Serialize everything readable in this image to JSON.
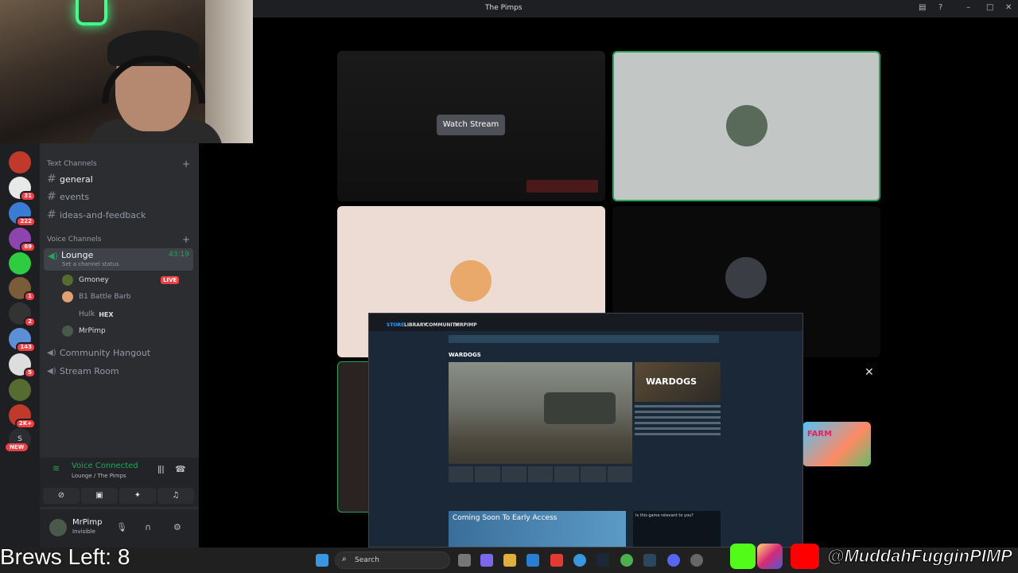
{
  "window": {
    "title": "The Pimps"
  },
  "server_badges": [
    "31",
    "222",
    "69",
    "1",
    "2",
    "143",
    "5",
    "2K+"
  ],
  "server_new_badge": "NEW",
  "server_letter": "S",
  "sidebar": {
    "text_category": "Text Channels",
    "text_channels": [
      "general",
      "events",
      "ideas-and-feedback"
    ],
    "voice_category": "Voice Channels",
    "lounge": {
      "name": "Lounge",
      "status_placeholder": "Set a channel status",
      "timer": "43:19"
    },
    "members": [
      {
        "name": "Gmoney",
        "badge": "LIVE"
      },
      {
        "name": "B1 Battle Barb"
      },
      {
        "name": "Hulk",
        "tag": "HEX"
      },
      {
        "name": "MrPimp"
      }
    ],
    "other_voice": [
      "Community Hangout",
      "Stream Room"
    ]
  },
  "voice_panel": {
    "title": "Voice Connected",
    "subtitle": "Lounge / The Pimps"
  },
  "user_bar": {
    "name": "MrPimp",
    "status": "Invisible"
  },
  "stage": {
    "watch_label": "Watch Stream",
    "close_icon": "close-icon"
  },
  "farm_label": "FARM",
  "steam": {
    "nav": [
      "STORE",
      "LIBRARY",
      "COMMUNITY",
      "MRPIMP"
    ],
    "game_title": "WARDOGS",
    "capsule_label": "WARDOGS",
    "coming_soon": "Coming Soon To Early Access",
    "relevant": "Is this game relevant to you?"
  },
  "overlay": {
    "brews": "Brews Left: 8",
    "handle": "@MuddahFugginPIMP"
  },
  "taskbar": {
    "search_placeholder": "Search"
  },
  "colors": {
    "accent_green": "#23a559",
    "live_red": "#f23f43",
    "steam_blue": "#1a9fff"
  }
}
